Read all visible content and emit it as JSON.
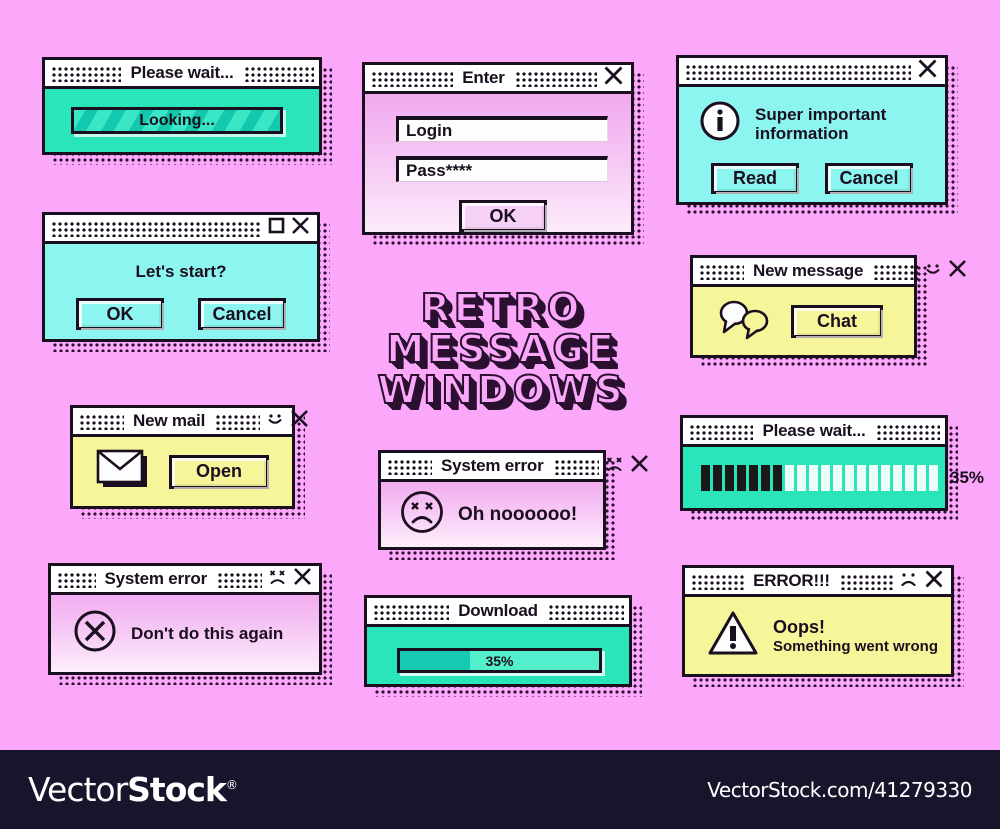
{
  "page": {
    "background_color": "#fba8fb",
    "title_art": [
      "RETRO",
      "MESSAGE",
      "WINDOWS"
    ]
  },
  "colors": {
    "background_pink": "#fba8fb",
    "teal": "#2ae5b9",
    "cyan": "#8df5f0",
    "yellow": "#f7f59a",
    "pink_panel": "#f2acf0",
    "ink": "#1a0f1f",
    "footer_bg": "#16152b"
  },
  "windows": {
    "please_wait_looking": {
      "title": "Please wait...",
      "progress_label": "Looking..."
    },
    "lets_start": {
      "title": "",
      "message": "Let's start?",
      "ok_label": "OK",
      "cancel_label": "Cancel"
    },
    "new_mail": {
      "title": "New mail",
      "open_label": "Open"
    },
    "system_error_dont": {
      "title": "System error",
      "message": "Don't do this again"
    },
    "enter": {
      "title": "Enter",
      "login_value": "Login",
      "login_placeholder": "Login",
      "pass_value": "Pass****",
      "pass_placeholder": "Pass",
      "ok_label": "OK"
    },
    "system_error_ohno": {
      "title": "System error",
      "message": "Oh noooooo!"
    },
    "download": {
      "title": "Download",
      "percent_label": "35%",
      "percent_value": 35
    },
    "super_info": {
      "title": "",
      "message_line1": "Super important",
      "message_line2": "information",
      "read_label": "Read",
      "cancel_label": "Cancel"
    },
    "new_message": {
      "title": "New message",
      "chat_label": "Chat"
    },
    "please_wait_blocks": {
      "title": "Please wait...",
      "percent_label": "35%",
      "percent_value": 35,
      "blocks_total": 20,
      "blocks_filled": 7
    },
    "error": {
      "title": "ERROR!!!",
      "message_line1": "Oops!",
      "message_line2": "Something went wrong"
    }
  },
  "footer": {
    "logo_light": "Vector",
    "logo_bold": "Stock",
    "registered": "®",
    "url": "VectorStock.com/41279330"
  }
}
